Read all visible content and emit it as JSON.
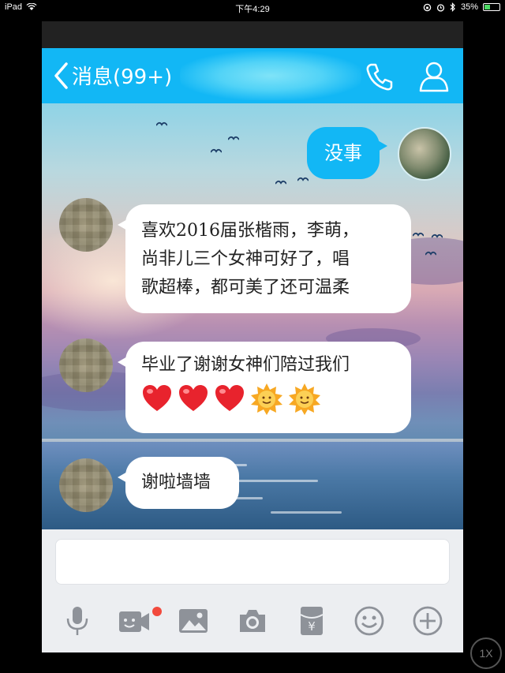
{
  "statusbar": {
    "device": "iPad",
    "time": "下午4:29",
    "battery": "35%"
  },
  "nav": {
    "back_label": "消息(99+)"
  },
  "messages": [
    {
      "direction": "out",
      "text": "没事"
    },
    {
      "direction": "in",
      "lines": [
        "喜欢2016届张楷雨，李萌，",
        "尚非儿三个女神可好了，唱",
        "歌超棒，都可美了还可温柔"
      ]
    },
    {
      "direction": "in",
      "lines": [
        "毕业了谢谢女神们陪过我们"
      ],
      "emoji": [
        "heart-icon",
        "heart-icon",
        "heart-icon",
        "sun-smile-icon",
        "sun-smile-icon"
      ]
    },
    {
      "direction": "in",
      "text": "谢啦墙墙"
    }
  ],
  "toolbar": {
    "icons": [
      "microphone-icon",
      "video-call-icon",
      "image-icon",
      "camera-icon",
      "red-packet-icon",
      "emoji-icon",
      "plus-icon"
    ],
    "red_packet_symbol": "¥"
  },
  "overlay": {
    "speed_label": "1X"
  },
  "colors": {
    "accent": "#12b7f5",
    "notification_dot": "#f24a3d",
    "icon_gray": "#8e9299"
  }
}
